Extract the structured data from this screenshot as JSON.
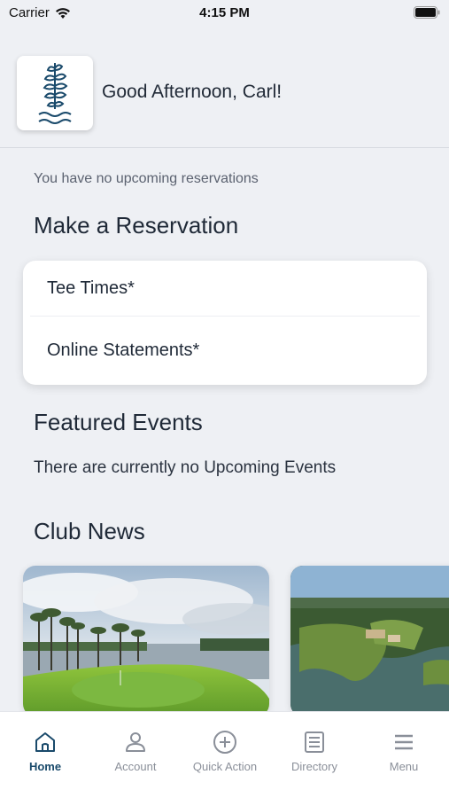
{
  "status_bar": {
    "carrier": "Carrier",
    "time": "4:15 PM"
  },
  "header": {
    "greeting": "Good Afternoon, Carl!"
  },
  "reservations": {
    "empty_text": "You have no upcoming reservations"
  },
  "make_reservation": {
    "title": "Make a Reservation",
    "items": [
      {
        "label": "Tee Times*"
      },
      {
        "label": "Online Statements*"
      }
    ]
  },
  "featured_events": {
    "title": "Featured Events",
    "empty_text": "There are currently no Upcoming Events"
  },
  "club_news": {
    "title": "Club News",
    "cards": [
      {
        "image": "golf-green-lake-photo"
      },
      {
        "image": "aerial-golf-course-photo"
      }
    ]
  },
  "tabbar": {
    "active": "Home",
    "tabs": [
      {
        "label": "Home",
        "icon": "home-icon"
      },
      {
        "label": "Account",
        "icon": "account-icon"
      },
      {
        "label": "Quick Action",
        "icon": "plus-circle-icon"
      },
      {
        "label": "Directory",
        "icon": "list-icon"
      },
      {
        "label": "Menu",
        "icon": "hamburger-icon"
      }
    ]
  },
  "colors": {
    "brand": "#1a4a6b",
    "background": "#eef0f4",
    "inactive_tab": "#8a8f99"
  }
}
